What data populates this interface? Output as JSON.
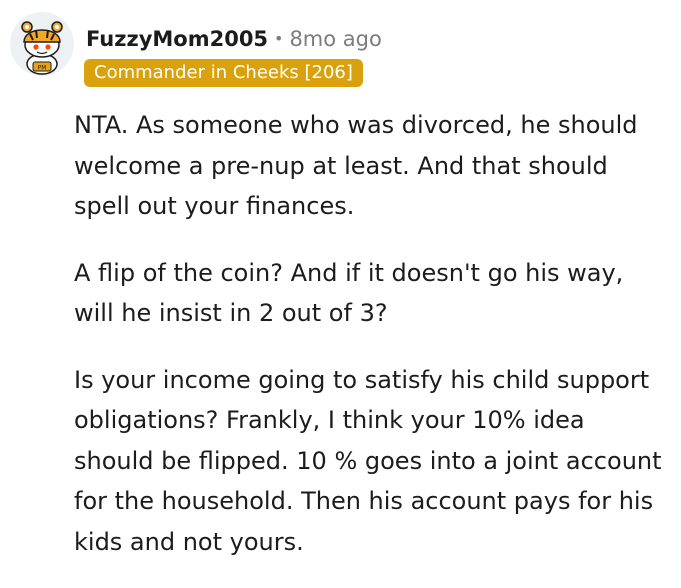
{
  "comment": {
    "author": "FuzzyMom2005",
    "separator": "•",
    "timestamp": "8mo ago",
    "flair": "Commander in Cheeks [206]",
    "paragraphs": [
      "NTA. As someone who was divorced, he should welcome a pre-nup at least. And that should spell out your finances.",
      "A flip of the coin? And if it doesn't go his way, will he insist in 2 out of 3?",
      "Is your income going to satisfy his child support obligations? Frankly, I think your 10% idea should be flipped. 10 % goes into a joint account for the household. Then his account pays for his kids and not yours."
    ]
  },
  "colors": {
    "flair_background": "#d9a10c",
    "flair_text": "#ffffff",
    "username": "#1c1c1c",
    "meta": "#7c7c7c",
    "body": "#1c1c1c"
  },
  "icons": {
    "avatar": "snoo-avatar-with-tiger-hat-icon"
  }
}
